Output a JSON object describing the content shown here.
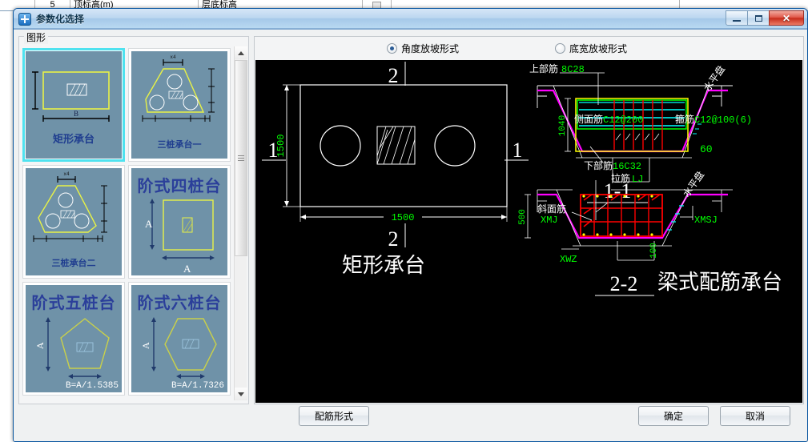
{
  "background": {
    "row": [
      "",
      "5",
      "顶标高(m)",
      "层底标高",
      "",
      ""
    ]
  },
  "window": {
    "title": "参数化选择",
    "icon": "plus-node-icon",
    "minimize": "—",
    "maximize": "□",
    "close": "✕"
  },
  "left_panel": {
    "caption": "图形",
    "scrollbar": {
      "up": "▲",
      "down": "▼"
    },
    "thumbnails": [
      {
        "label": "矩形承台",
        "shape": "rectangle",
        "selected": true,
        "dim_b": "B",
        "formula": ""
      },
      {
        "label": "三桩承台一",
        "shape": "triangle-3pile-a",
        "selected": false,
        "formula": ""
      },
      {
        "label": "三桩承台二",
        "shape": "triangle-3pile-b",
        "selected": false,
        "formula": ""
      },
      {
        "label": "阶式四桩台",
        "shape": "square-4pile",
        "selected": false,
        "dim_a": "A",
        "formula": ""
      },
      {
        "label": "阶式五桩台",
        "shape": "pentagon-5pile",
        "selected": false,
        "dim_a": "A",
        "formula": "B=A/1.5385"
      },
      {
        "label": "阶式六桩台",
        "shape": "hexagon-6pile",
        "selected": false,
        "dim_a": "A",
        "formula": "B=A/1.7326"
      }
    ]
  },
  "right_panel": {
    "radios": [
      {
        "label": "角度放坡形式",
        "selected": true
      },
      {
        "label": "底宽放坡形式",
        "selected": false
      }
    ],
    "drawing": {
      "plan": {
        "title": "矩形承台",
        "width_dim": "1500",
        "height_dim": "1500",
        "section_marks": [
          "1",
          "1",
          "2",
          "2"
        ]
      },
      "section_1_1": {
        "title": "1-1",
        "labels": {
          "top_bar": "上部筋",
          "top_bar_spec": "8C28",
          "side_bar": "侧面筋",
          "side_bar_spec": "C12@200",
          "stirrup": "箍筋",
          "stirrup_spec": "C12@100(6)",
          "bottom_bar": "下部筋",
          "bottom_bar_spec": "16C32",
          "angle": "60",
          "slope_text": "水平盘",
          "height_dim": "1040"
        }
      },
      "section_2_2": {
        "title": "2-2",
        "name": "梁式配筋承台",
        "labels": {
          "tie_bar": "拉筋",
          "tie_bar_code": "LJ",
          "slope_bar": "斜面筋",
          "slope_bar_code": "XMJ",
          "slope_face_code": "XMSJ",
          "outer_code": "XWZ",
          "height_dim": "500",
          "bottom_dim": "100",
          "slope_text": "水平盘"
        }
      },
      "colors": {
        "background": "#000000",
        "white": "#ffffff",
        "green": "#00ff00",
        "red": "#ff0000",
        "cyan": "#00ffff",
        "magenta": "#ff00ff",
        "yellow": "#ffff00"
      }
    }
  },
  "buttons": {
    "rebar_form": "配筋形式",
    "ok": "确定",
    "cancel": "取消"
  }
}
